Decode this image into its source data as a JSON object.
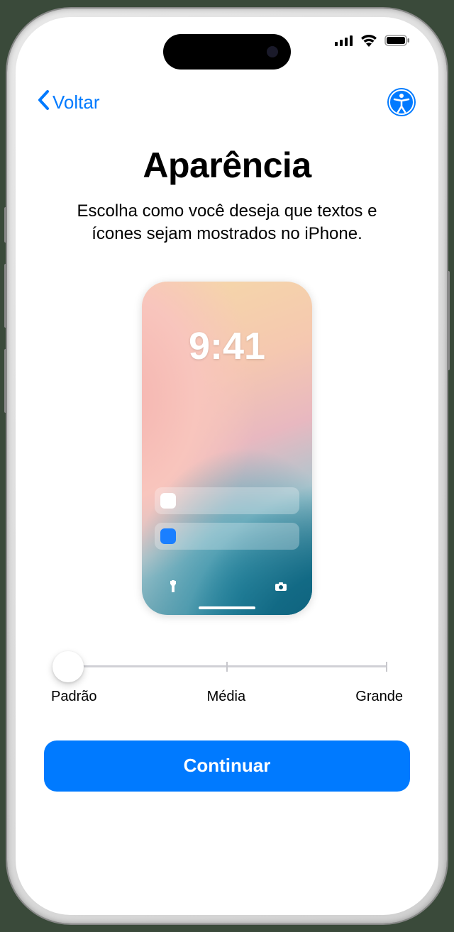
{
  "nav": {
    "back_label": "Voltar"
  },
  "page_title": "Aparência",
  "subtitle": "Escolha como você deseja que textos e ícones sejam mostrados no iPhone.",
  "preview": {
    "time": "9:41"
  },
  "slider": {
    "labels": [
      "Padrão",
      "Média",
      "Grande"
    ],
    "selected_index": 0
  },
  "continue_label": "Continuar",
  "colors": {
    "accent": "#007AFF"
  }
}
